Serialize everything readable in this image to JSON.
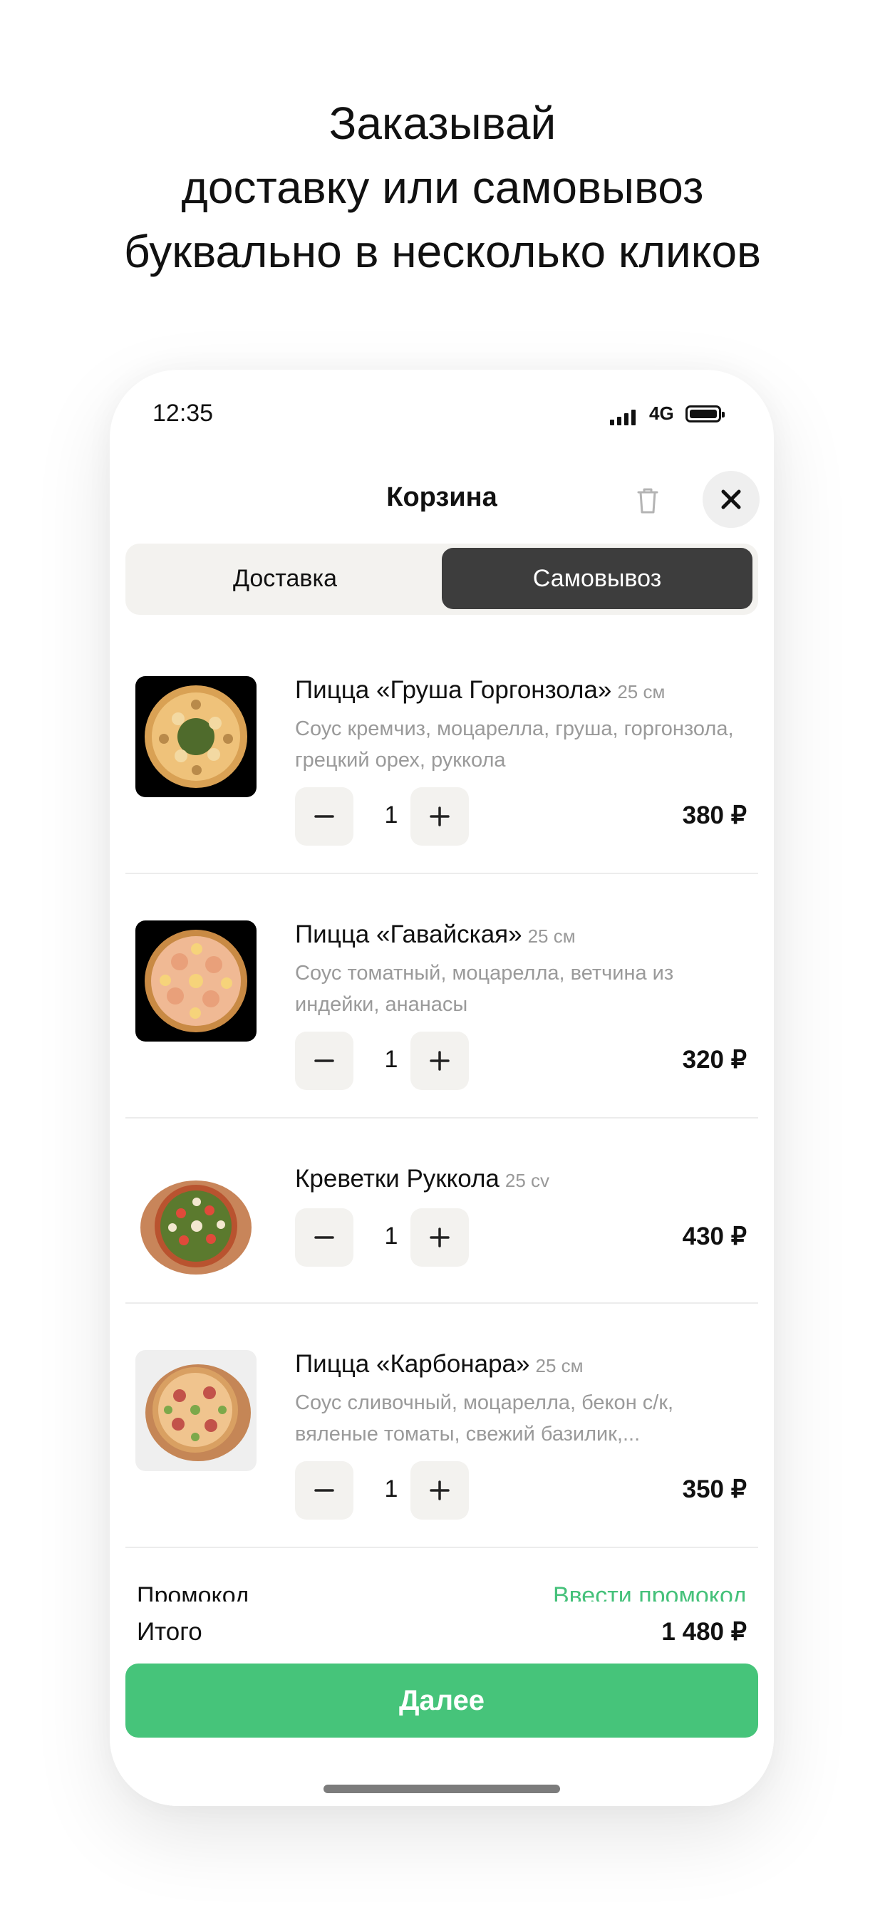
{
  "headline": [
    "Заказывай",
    "доставку или самовывоз",
    "буквально в несколько кликов"
  ],
  "status": {
    "time": "12:35",
    "network": "4G"
  },
  "cart": {
    "title": "Корзина",
    "tabs": [
      {
        "label": "Доставка",
        "selected": false
      },
      {
        "label": "Самовывоз",
        "selected": true
      }
    ],
    "items": [
      {
        "name": "Пицца «Груша Горгонзола»",
        "size": "25 см",
        "description": "Соус кремчиз, моцарелла, груша, горгонзола, грецкий орех, руккола",
        "quantity": "1",
        "price": "380 ₽"
      },
      {
        "name": "Пицца «Гавайская»",
        "size": "25 см",
        "description": "Соус томатный, моцарелла, ветчина из индейки, ананасы",
        "quantity": "1",
        "price": "320 ₽"
      },
      {
        "name": "Креветки Руккола",
        "size": "25 cv",
        "description": "",
        "quantity": "1",
        "price": "430 ₽"
      },
      {
        "name": "Пицца «Карбонара»",
        "size": "25 см",
        "description": "Соус сливочный, моцарелла, бекон с/к, вяленые томаты, свежий базилик,...",
        "quantity": "1",
        "price": "350 ₽"
      }
    ],
    "promo": {
      "label": "Промокод",
      "link": "Ввести промокод"
    },
    "total": {
      "label": "Итого",
      "value": "1 480 ₽"
    },
    "next_button": "Далее"
  },
  "colors": {
    "accent": "#46c47a",
    "promo_link": "#45c17a",
    "tab_selected_bg": "#3d3d3d",
    "control_bg": "#f3f2ef"
  },
  "icons": [
    "trash-icon",
    "close-icon",
    "minus-icon",
    "plus-icon",
    "signal-icon",
    "battery-icon"
  ]
}
